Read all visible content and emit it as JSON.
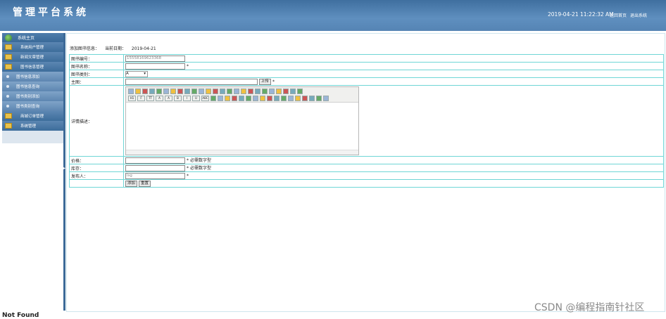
{
  "header": {
    "title": "管理平台系统",
    "datetime": "2019-04-21 11:22:32 AM",
    "links": [
      "返回首页",
      "退出系统"
    ]
  },
  "sidebar": {
    "home": "系统主页",
    "items": [
      {
        "label": "系统用户管理",
        "type": "cat"
      },
      {
        "label": "新闻文章管理",
        "type": "cat"
      },
      {
        "label": "图书信息管理",
        "type": "cat"
      },
      {
        "label": "图书信息添加",
        "type": "sub"
      },
      {
        "label": "图书信息查询",
        "type": "sub"
      },
      {
        "label": "图书类别添加",
        "type": "sub"
      },
      {
        "label": "图书类别查询",
        "type": "sub"
      },
      {
        "label": "商城订单管理",
        "type": "cat"
      },
      {
        "label": "系统管理",
        "type": "cat"
      }
    ]
  },
  "page": {
    "heading": "添加图书信息：",
    "date_label": "当前日期：",
    "date": "2019-04-21"
  },
  "form": {
    "book_no_label": "图书编号：",
    "book_no_value": "15558169623368",
    "book_name_label": "图书名称：",
    "book_type_label": "图书类别：",
    "book_type_value": "A",
    "image_label": "主图：",
    "upload_label": "上传",
    "detail_label": "详情描述：",
    "price_label": "价格：",
    "price_hint": "必需数字型",
    "stock_label": "库存：",
    "stock_hint": "必需数字型",
    "publisher_label": "发布人：",
    "publisher_value": "lsg",
    "required_mark": "*",
    "add_button": "添加",
    "reset_button": "重置"
  },
  "editor_toolbar": {
    "row1": [
      "source-icon",
      "undo-icon",
      "redo-icon",
      "find-icon",
      "print-icon",
      "preview-icon",
      "template-icon",
      "cut-icon",
      "copy-icon",
      "paste-icon",
      "paste-text-icon",
      "paste-word-icon",
      "align-left-icon",
      "align-center-icon",
      "align-right-icon",
      "justify-icon",
      "ordered-list-icon",
      "unordered-list-icon",
      "indent-icon",
      "outdent-icon",
      "subscript-icon",
      "superscript-icon",
      "clear-format-icon",
      "select-all-icon",
      "fullscreen-icon"
    ],
    "row2": [
      "heading-icon",
      "font-family-icon",
      "font-size-icon",
      "font-color-icon",
      "highlight-icon",
      "bold-icon",
      "italic-icon",
      "underline-icon",
      "strikethrough-icon",
      "line-height-icon",
      "remove-format-icon",
      "image-icon",
      "multi-image-icon",
      "flash-icon",
      "media-icon",
      "insert-file-icon",
      "table-icon",
      "hr-icon",
      "emoticon-icon",
      "map-icon",
      "code-icon",
      "pagebreak-icon",
      "anchor-icon",
      "link-icon",
      "unlink-icon",
      "about-icon"
    ],
    "row2_text": {
      "heading": "H1",
      "font_family": "F",
      "font_size": "TT",
      "font_color": "A",
      "highlight": "A",
      "bold": "B",
      "italic": "I",
      "underline": "U",
      "strikethrough": "ABC"
    }
  },
  "watermark": "CSDN @编程指南针社区",
  "bottom_text": "Not Found"
}
